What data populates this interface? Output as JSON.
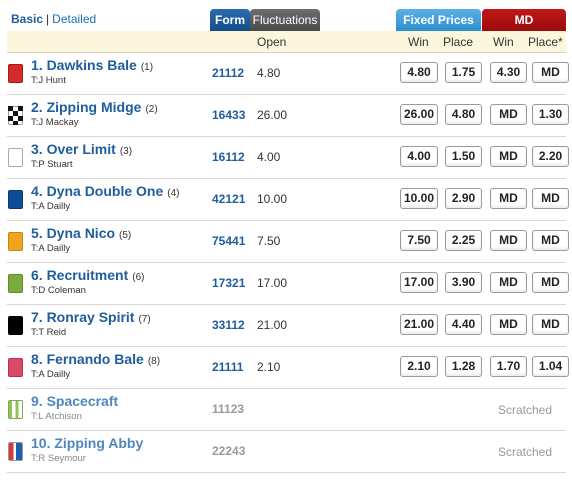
{
  "view_toggle": {
    "basic": "Basic",
    "separator": "|",
    "detailed": "Detailed"
  },
  "tabs": {
    "form": "Form",
    "fluctuations": "Fluctuations",
    "fixed_prices": "Fixed Prices",
    "md": "MD"
  },
  "columns": {
    "open": "Open",
    "win": "Win",
    "place": "Place",
    "md_win": "Win",
    "md_place": "Place*"
  },
  "colors": {
    "accent_blue": "#1f5d9c",
    "fixed_tab": "#3d9ad8",
    "md_tab": "#b01212",
    "header_bg": "#fbf6dc"
  },
  "runners": [
    {
      "name": "1. Dawkins Bale",
      "barrier": "(1)",
      "trainer": "T:J Hunt",
      "form": "21112",
      "open": "4.80",
      "win": "4.80",
      "place": "1.75",
      "md_win": "4.30",
      "md_place": "MD",
      "silk": "red"
    },
    {
      "name": "2. Zipping Midge",
      "barrier": "(2)",
      "trainer": "T:J Mackay",
      "form": "16433",
      "open": "26.00",
      "win": "26.00",
      "place": "4.80",
      "md_win": "MD",
      "md_place": "1.30",
      "silk": "checkered"
    },
    {
      "name": "3. Over Limit",
      "barrier": "(3)",
      "trainer": "T:P Stuart",
      "form": "16112",
      "open": "4.00",
      "win": "4.00",
      "place": "1.50",
      "md_win": "MD",
      "md_place": "2.20",
      "silk": "white"
    },
    {
      "name": "4. Dyna Double One",
      "barrier": "(4)",
      "trainer": "T:A Dailly",
      "form": "42121",
      "open": "10.00",
      "win": "10.00",
      "place": "2.90",
      "md_win": "MD",
      "md_place": "MD",
      "silk": "blue"
    },
    {
      "name": "5. Dyna Nico",
      "barrier": "(5)",
      "trainer": "T:A Dailly",
      "form": "75441",
      "open": "7.50",
      "win": "7.50",
      "place": "2.25",
      "md_win": "MD",
      "md_place": "MD",
      "silk": "orange"
    },
    {
      "name": "6. Recruitment",
      "barrier": "(6)",
      "trainer": "T:D Coleman",
      "form": "17321",
      "open": "17.00",
      "win": "17.00",
      "place": "3.90",
      "md_win": "MD",
      "md_place": "MD",
      "silk": "green"
    },
    {
      "name": "7. Ronray Spirit",
      "barrier": "(7)",
      "trainer": "T:T Reid",
      "form": "33112",
      "open": "21.00",
      "win": "21.00",
      "place": "4.40",
      "md_win": "MD",
      "md_place": "MD",
      "silk": "black"
    },
    {
      "name": "8. Fernando Bale",
      "barrier": "(8)",
      "trainer": "T:A Dailly",
      "form": "21111",
      "open": "2.10",
      "win": "2.10",
      "place": "1.28",
      "md_win": "1.70",
      "md_place": "1.04",
      "silk": "pink"
    },
    {
      "name": "9. Spacecraft",
      "trainer": "T:L Atchison",
      "form": "11123",
      "status": "Scratched",
      "silk": "green-stripes"
    },
    {
      "name": "10. Zipping Abby",
      "trainer": "T:R Seymour",
      "form": "22243",
      "status": "Scratched",
      "silk": "red-white-blue"
    }
  ]
}
